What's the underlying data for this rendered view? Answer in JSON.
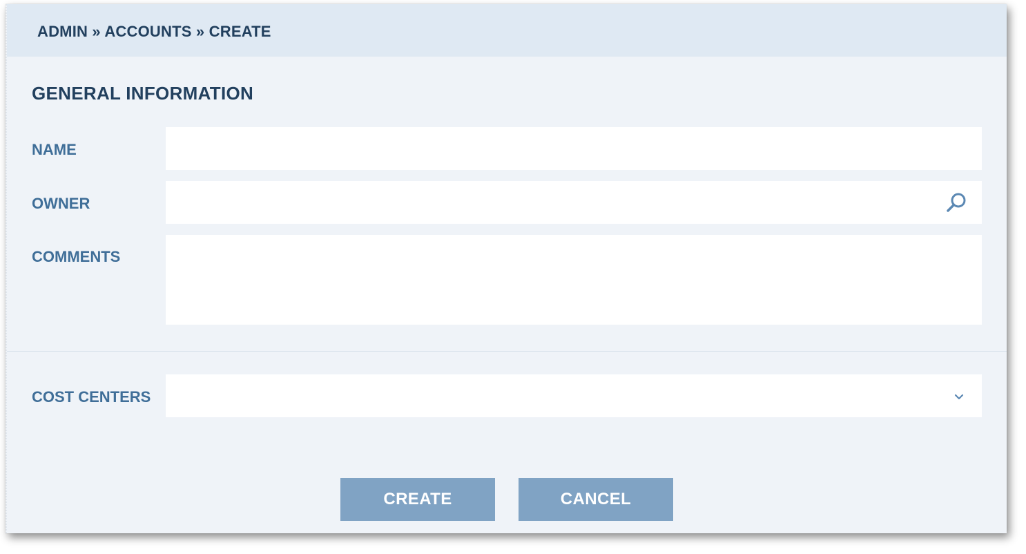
{
  "breadcrumb": "ADMIN » ACCOUNTS » CREATE",
  "section": {
    "title": "GENERAL INFORMATION"
  },
  "form": {
    "name_label": "NAME",
    "name_value": "",
    "owner_label": "OWNER",
    "owner_value": "",
    "comments_label": "COMMENTS",
    "comments_value": "",
    "cost_centers_label": "COST CENTERS",
    "cost_centers_value": ""
  },
  "icons": {
    "owner_search": "search-icon",
    "cost_centers_dropdown": "chevron-down-icon"
  },
  "buttons": {
    "create_label": "CREATE",
    "cancel_label": "CANCEL"
  },
  "colors": {
    "header_bg": "#dfe9f3",
    "panel_bg": "#eff3f8",
    "title_text": "#22405e",
    "label_text": "#3f6e98",
    "button_bg": "#80a3c4",
    "icon": "#5b88b3"
  }
}
